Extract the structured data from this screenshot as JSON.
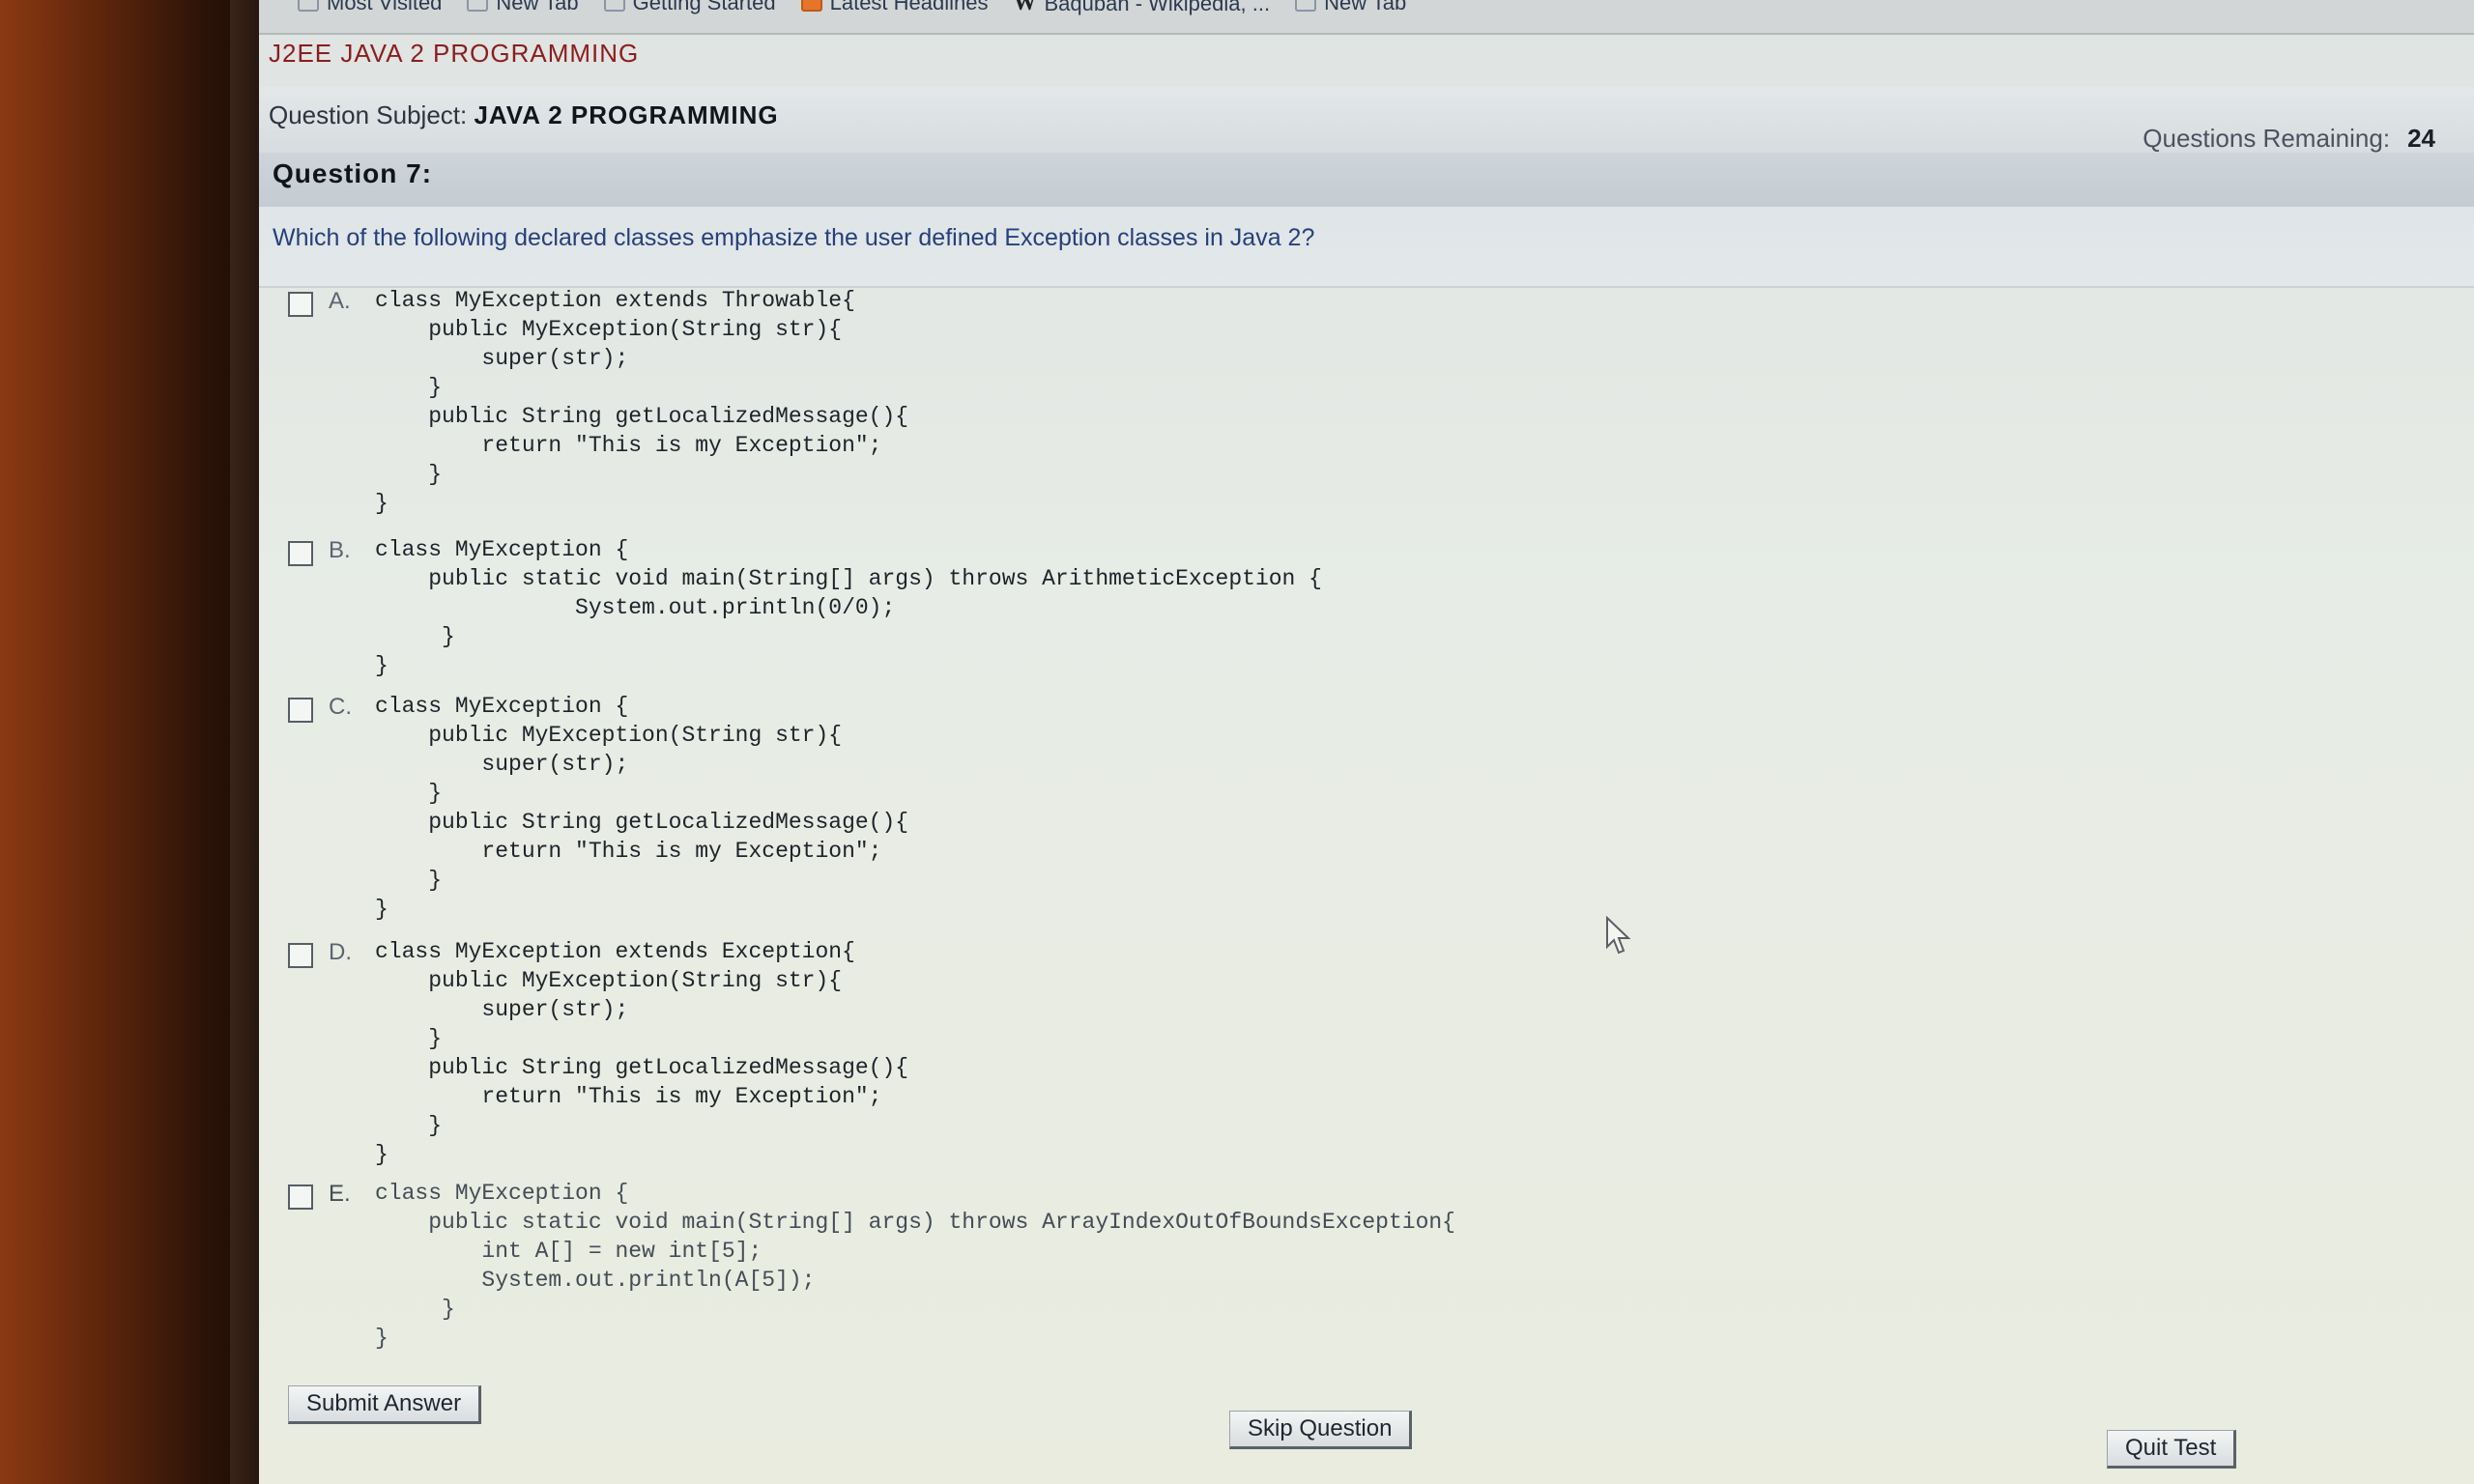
{
  "bookmarks": [
    {
      "label": "Most Visited",
      "icon": "star-icon"
    },
    {
      "label": "New Tab",
      "icon": "page-icon"
    },
    {
      "label": "Getting Started",
      "icon": "page-icon"
    },
    {
      "label": "Latest Headlines",
      "icon": "rss-icon"
    },
    {
      "label": "Baqubah - Wikipedia, ...",
      "icon": "wikipedia-icon",
      "glyph": "W"
    },
    {
      "label": "New Tab",
      "icon": "page-icon"
    }
  ],
  "app": {
    "title": "J2EE JAVA 2 PROGRAMMING",
    "subject_label": "Question Subject:",
    "subject_value": "JAVA 2 PROGRAMMING",
    "remaining_label": "Questions Remaining:",
    "remaining_value": "24"
  },
  "question": {
    "number_label": "Question 7:",
    "text": "Which of the following declared classes emphasize the user defined Exception classes in Java 2?"
  },
  "options": [
    {
      "letter": "A.",
      "code": "class MyException extends Throwable{\n    public MyException(String str){\n        super(str);\n    }\n    public String getLocalizedMessage(){\n        return \"This is my Exception\";\n    }\n}"
    },
    {
      "letter": "B.",
      "code": "class MyException {\n    public static void main(String[] args) throws ArithmeticException {\n               System.out.println(0/0);\n     }\n}"
    },
    {
      "letter": "C.",
      "code": "class MyException {\n    public MyException(String str){\n        super(str);\n    }\n    public String getLocalizedMessage(){\n        return \"This is my Exception\";\n    }\n}"
    },
    {
      "letter": "D.",
      "code": "class MyException extends Exception{\n    public MyException(String str){\n        super(str);\n    }\n    public String getLocalizedMessage(){\n        return \"This is my Exception\";\n    }\n}"
    },
    {
      "letter": "E.",
      "code": "class MyException {\n    public static void main(String[] args) throws ArrayIndexOutOfBoundsException{\n        int A[] = new int[5];\n        System.out.println(A[5]);\n     }\n}"
    }
  ],
  "buttons": {
    "submit": "Submit Answer",
    "skip": "Skip Question",
    "quit": "Quit Test"
  }
}
